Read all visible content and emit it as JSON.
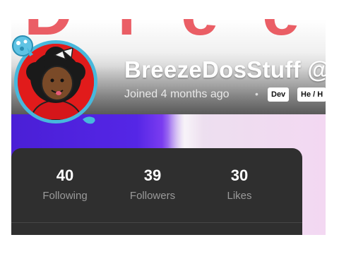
{
  "banner": {
    "letters": [
      "D",
      "r",
      "e",
      "e"
    ]
  },
  "profile": {
    "username": "BreezeDosStuff @",
    "joined": "Joined 4 months ago",
    "separator": "•",
    "badges": [
      "Dev",
      "He / H"
    ]
  },
  "stats": [
    {
      "value": "40",
      "label": "Following"
    },
    {
      "value": "39",
      "label": "Followers"
    },
    {
      "value": "30",
      "label": "Likes"
    }
  ],
  "colors": {
    "avatar_background": "#e11b1b",
    "avatar_ring": "#47b8dc",
    "card_background": "#2f2f2f",
    "banner_letter": "#e8434c"
  }
}
